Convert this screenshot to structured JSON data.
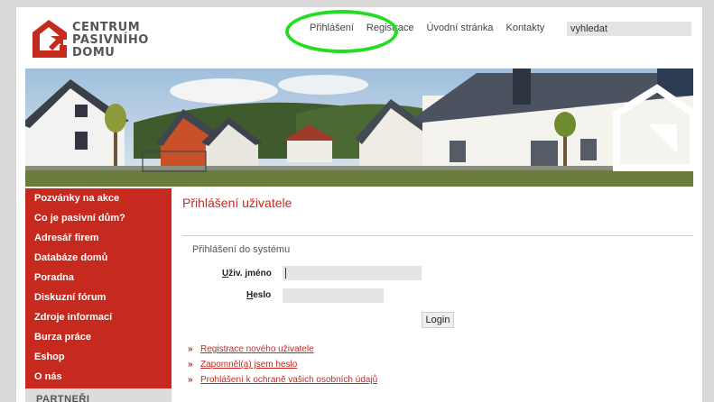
{
  "logo": {
    "line1": "CENTRUM",
    "line2": "PASIVNÍHO",
    "line3": "DOMU"
  },
  "topnav": {
    "items": [
      "Přihlášení",
      "Registrace",
      "Úvodní stránka",
      "Kontakty"
    ]
  },
  "search": {
    "value": "vyhledat"
  },
  "sidebar": {
    "items": [
      "Pozvánky na akce",
      "Co je pasivní dům?",
      "Adresář firem",
      "Databáze domů",
      "Poradna",
      "Diskuzní fórum",
      "Zdroje informací",
      "Burza práce",
      "Eshop",
      "O nás"
    ],
    "partners": "PARTNEŘI"
  },
  "main": {
    "title": "Přihlášení uživatele",
    "section_title": "Přihlášení do systému",
    "user_label_accel": "U",
    "user_label_rest": "živ. jméno",
    "pass_label_accel": "H",
    "pass_label_rest": "eslo",
    "login_button": "Login",
    "links": [
      "Registrace nového uživatele",
      "Zapomněl(a) jsem heslo",
      "Prohlášení k ochraně vašich osobních údajů"
    ],
    "link_arrow": "»"
  },
  "colors": {
    "brand_red": "#c62a1f",
    "highlight_green": "#22dd22"
  }
}
